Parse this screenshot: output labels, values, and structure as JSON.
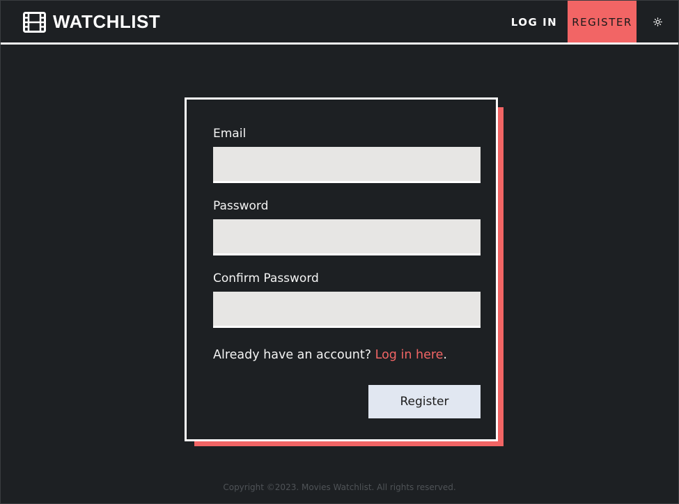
{
  "header": {
    "brand_title": "WATCHLIST",
    "logo_icon": "film-strip-icon",
    "nav": {
      "login_label": "LOG IN",
      "register_label": "REGISTER"
    },
    "theme_toggle_icon": "sun-icon"
  },
  "form": {
    "email_label": "Email",
    "email_value": "",
    "password_label": "Password",
    "password_value": "",
    "confirm_password_label": "Confirm Password",
    "confirm_password_value": "",
    "switch_prefix": "Already have an account?",
    "switch_link": "Log in here",
    "switch_suffix": ".",
    "submit_label": "Register"
  },
  "footer": {
    "copyright": "Copyright ©2023. Movies Watchlist. All rights reserved."
  },
  "colors": {
    "background": "#1d2023",
    "accent": "#f26565",
    "input_background": "#e7e6e4",
    "button_background": "#e1e7f1"
  }
}
